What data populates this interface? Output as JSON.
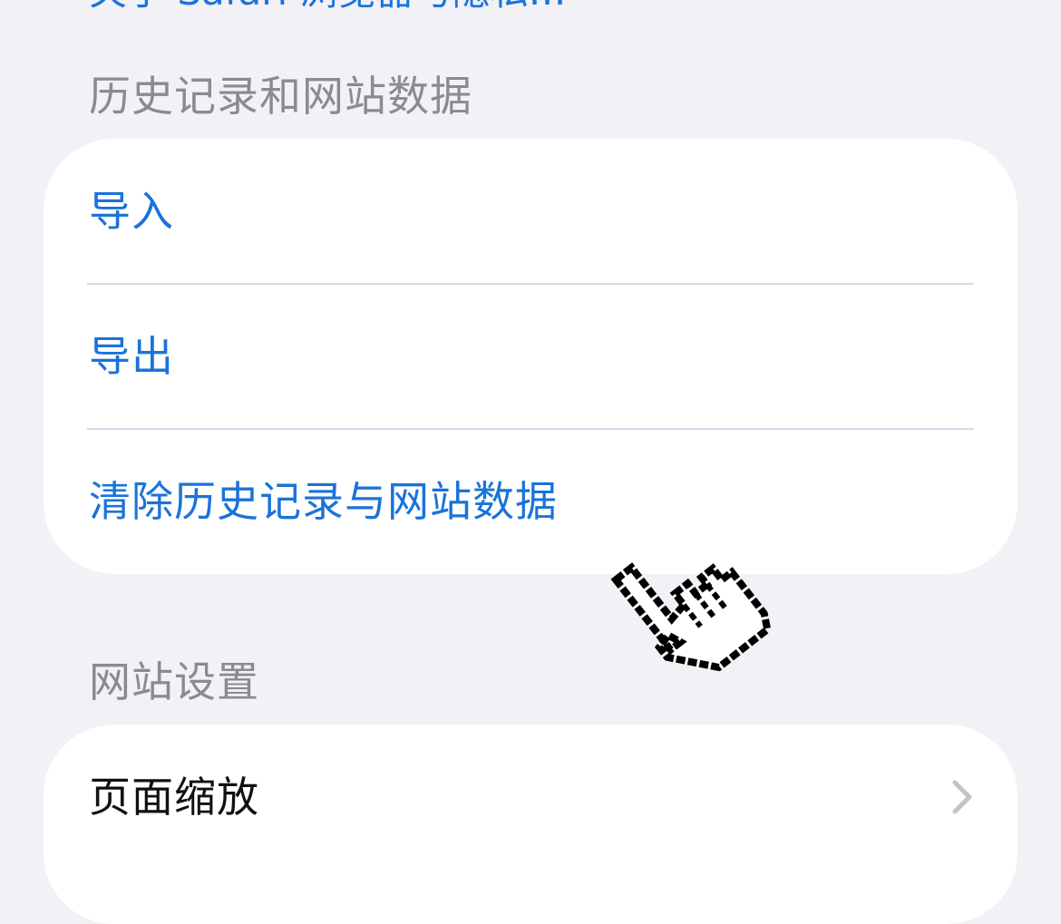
{
  "top_link": {
    "label": "关于 Safari 浏览器与隐私…"
  },
  "history_section": {
    "header": "历史记录和网站数据",
    "items": [
      {
        "label": "导入"
      },
      {
        "label": "导出"
      },
      {
        "label": "清除历史记录与网站数据"
      }
    ]
  },
  "website_settings_section": {
    "header": "网站设置",
    "items": [
      {
        "label": "页面缩放",
        "accessory": "chevron-right-icon"
      }
    ]
  },
  "colors": {
    "background": "#f2f1f6",
    "card": "#ffffff",
    "link": "#1a73d9",
    "header": "#8a8a8f",
    "text": "#111111",
    "divider": "#d4d9ea"
  },
  "overlay": {
    "icon": "hand-pointer-cursor-icon"
  }
}
